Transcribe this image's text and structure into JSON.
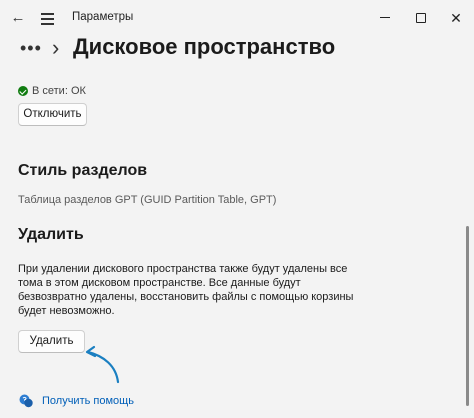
{
  "window": {
    "title": "Параметры"
  },
  "breadcrumb": {
    "dots": "•••",
    "separator": "›",
    "title": "Дисковое пространство"
  },
  "status": {
    "text": "В сети: ОК",
    "color": "#107c10"
  },
  "buttons": {
    "disconnect": "Отключить",
    "delete": "Удалить"
  },
  "sections": {
    "partition_style": {
      "heading": "Стиль разделов",
      "value": "Таблица разделов GPT (GUID Partition Table, GPT)"
    },
    "delete": {
      "heading": "Удалить",
      "description": "При удалении дискового пространства также будут удалены все тома в этом дисковом пространстве. Все данные будут безвозвратно удалены, восстановить файлы с помощью корзины будет невозможно."
    }
  },
  "help": {
    "label": "Получить помощь",
    "link_color": "#005fb8"
  },
  "icons": {
    "back": "back-arrow-icon",
    "menu": "hamburger-menu-icon",
    "minimize": "minimize-icon",
    "maximize": "maximize-icon",
    "close": "close-icon",
    "status": "checkmark-circle-icon",
    "help": "help-chat-icon",
    "annotation": "annotation-arrow-icon"
  },
  "accent_color": "#1a7fc1"
}
